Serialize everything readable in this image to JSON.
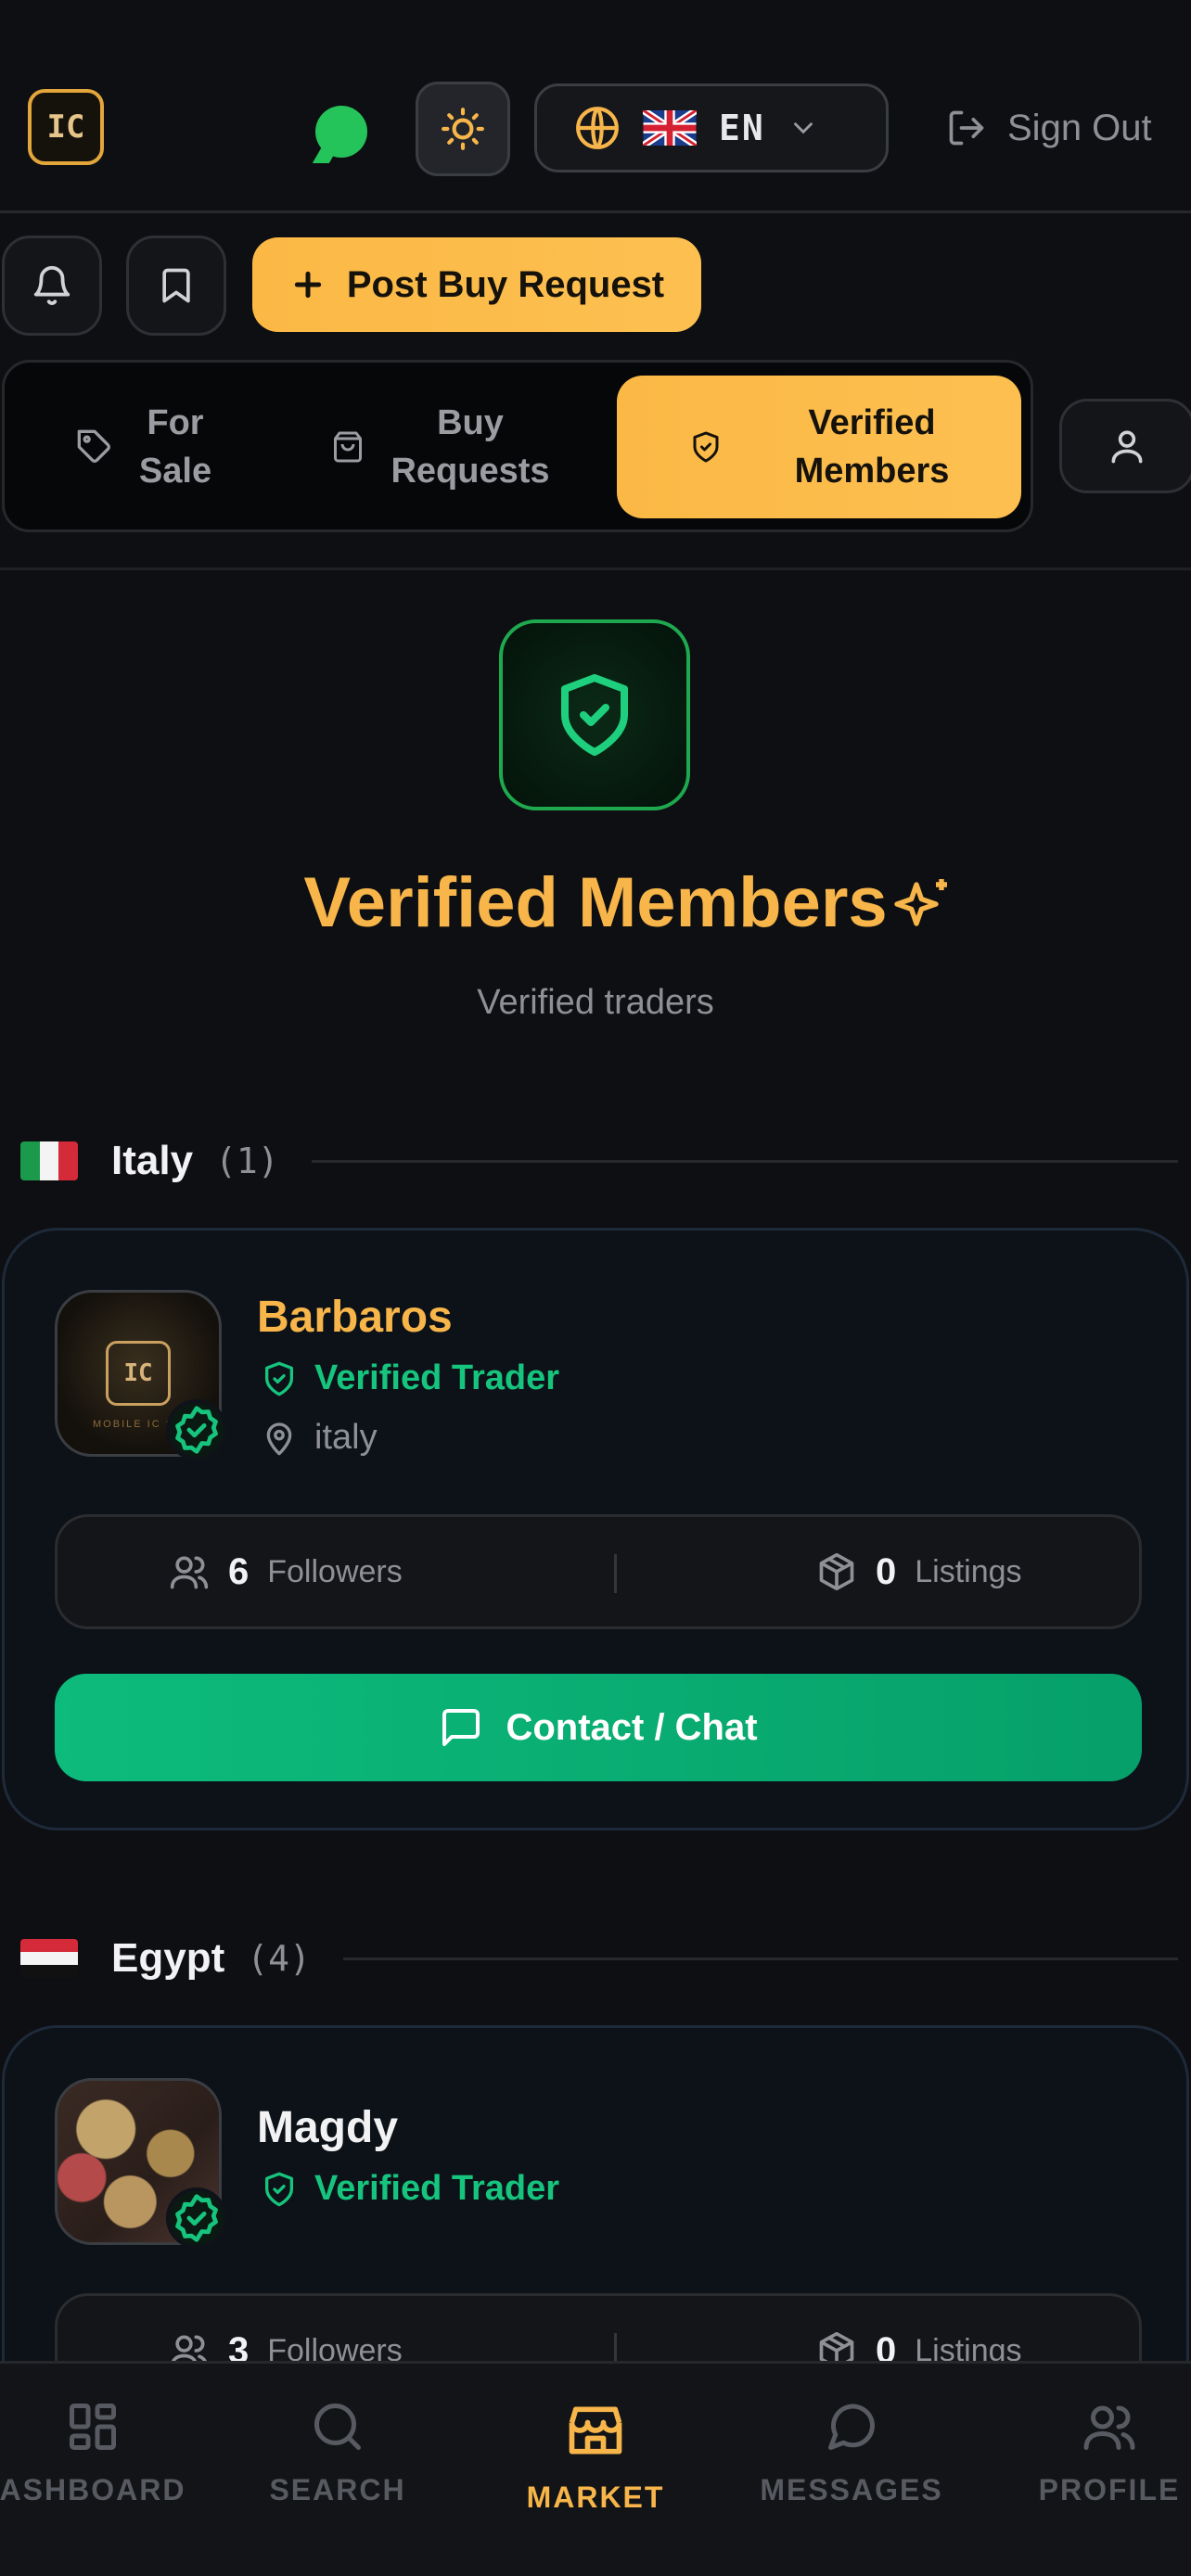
{
  "header": {
    "logo_text": "IC",
    "language_code": "EN",
    "sign_out_label": "Sign Out"
  },
  "actions": {
    "post_buy_request_label": "Post Buy Request"
  },
  "tabs": [
    {
      "label_line1": "For",
      "label_line2": "Sale",
      "active": false
    },
    {
      "label_line1": "Buy",
      "label_line2": "Requests",
      "active": false
    },
    {
      "label_line1": "Verified",
      "label_line2": "Members",
      "active": true
    }
  ],
  "hero": {
    "title": "Verified Members",
    "subtitle": "Verified traders"
  },
  "groups": [
    {
      "country": "Italy",
      "count": "(1)",
      "members": [
        {
          "name": "Barbaros",
          "badge": "Verified Trader",
          "location": "italy",
          "avatar_text": "IC",
          "avatar_caption": "MOBILE IC SH",
          "followers": "6",
          "followers_label": "Followers",
          "listings": "0",
          "listings_label": "Listings",
          "contact_label": "Contact / Chat"
        }
      ]
    },
    {
      "country": "Egypt",
      "count": "(4)",
      "members": [
        {
          "name": "Magdy",
          "badge": "Verified Trader",
          "followers": "3",
          "followers_label": "Followers",
          "listings": "0",
          "listings_label": "Listings"
        }
      ]
    }
  ],
  "bottom_nav": [
    {
      "label": "ASHBOARD",
      "icon": "grid-icon",
      "active": false
    },
    {
      "label": "SEARCH",
      "icon": "search-icon",
      "active": false
    },
    {
      "label": "MARKET",
      "icon": "store-icon",
      "active": true
    },
    {
      "label": "MESSAGES",
      "icon": "chat-bubble-icon",
      "active": false
    },
    {
      "label": "PROFILE",
      "icon": "users-icon",
      "active": false
    }
  ],
  "colors": {
    "accent": "#f7b54a",
    "verified_green": "#17c47e",
    "contact_button": "#0dbb7c",
    "background": "#0e0f12"
  }
}
